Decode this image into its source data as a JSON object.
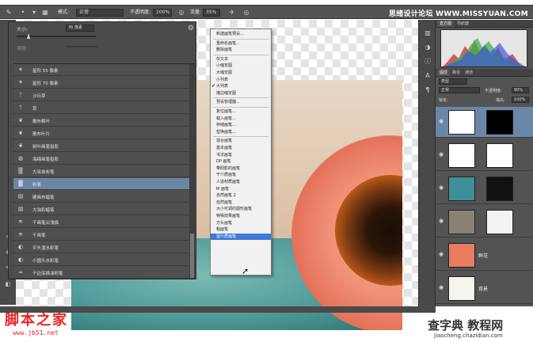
{
  "options_bar": {
    "mode_label": "模式:",
    "mode_value": "正常",
    "opacity_label": "不透明度:",
    "opacity_value": "100%",
    "flow_label": "流量:",
    "flow_value": "35%",
    "watermark": "思绪设计论坛 WWW.MISSYUAN.COM"
  },
  "brush_picker": {
    "size_label": "大小:",
    "size_value": "36 像素",
    "hardness_label": "硬度:",
    "items": [
      {
        "label": "星形 55 像素",
        "icon": "brush-star-icon",
        "selected": false
      },
      {
        "label": "星形 70 像素",
        "icon": "brush-star-icon",
        "selected": false
      },
      {
        "label": "沙丘草",
        "icon": "brush-grass-icon",
        "selected": false
      },
      {
        "label": "草",
        "icon": "brush-grass-icon",
        "selected": false
      },
      {
        "label": "散布枫叶",
        "icon": "brush-leaf-icon",
        "selected": false
      },
      {
        "label": "散布叶片",
        "icon": "brush-leaf-icon",
        "selected": false
      },
      {
        "label": "树叶画笔投影",
        "icon": "brush-leaf-icon",
        "selected": false
      },
      {
        "label": "海绵画笔投影",
        "icon": "brush-sponge-icon",
        "selected": false
      },
      {
        "label": "大涂抹炭笔",
        "icon": "brush-charcoal-icon",
        "selected": false
      },
      {
        "label": "粉笔",
        "icon": "brush-chalk-icon",
        "selected": true
      },
      {
        "label": "硬画布蜡笔",
        "icon": "brush-crayon-icon",
        "selected": false
      },
      {
        "label": "大油彩蜡笔",
        "icon": "brush-crayon-icon",
        "selected": false
      },
      {
        "label": "干画笔尖浅描",
        "icon": "brush-dry-icon",
        "selected": false
      },
      {
        "label": "干画笔",
        "icon": "brush-dry-icon",
        "selected": false
      },
      {
        "label": "平头湿水彩笔",
        "icon": "brush-wet-icon",
        "selected": false
      },
      {
        "label": "小圆头水彩笔",
        "icon": "brush-wet-icon",
        "selected": false
      },
      {
        "label": "干边深描油彩笔",
        "icon": "brush-oil-icon",
        "selected": false
      }
    ]
  },
  "context_menu": {
    "items": [
      {
        "label": "新建画笔预设...",
        "type": "item"
      },
      {
        "type": "sep"
      },
      {
        "label": "重命名画笔...",
        "type": "item"
      },
      {
        "label": "删除画笔",
        "type": "item"
      },
      {
        "type": "sep"
      },
      {
        "label": "仅文本",
        "type": "item"
      },
      {
        "label": "小缩览图",
        "type": "item"
      },
      {
        "label": "大缩览图",
        "type": "item"
      },
      {
        "label": "小列表",
        "type": "item"
      },
      {
        "label": "大列表",
        "type": "item",
        "checked": true
      },
      {
        "label": "描边缩览图",
        "type": "item"
      },
      {
        "type": "sep"
      },
      {
        "label": "预设管理器...",
        "type": "item"
      },
      {
        "type": "sep"
      },
      {
        "label": "复位画笔...",
        "type": "item"
      },
      {
        "label": "载入画笔...",
        "type": "item"
      },
      {
        "label": "存储画笔...",
        "type": "item"
      },
      {
        "label": "替换画笔...",
        "type": "item"
      },
      {
        "type": "sep"
      },
      {
        "label": "混合画笔",
        "type": "item"
      },
      {
        "label": "基本画笔",
        "type": "item"
      },
      {
        "label": "书法画笔",
        "type": "item"
      },
      {
        "label": "DP 画笔",
        "type": "item"
      },
      {
        "label": "带阴影的画笔",
        "type": "item"
      },
      {
        "label": "干介质画笔",
        "type": "item"
      },
      {
        "label": "人造材质画笔",
        "type": "item"
      },
      {
        "label": "M 画笔",
        "type": "item"
      },
      {
        "label": "自然画笔 2",
        "type": "item"
      },
      {
        "label": "自然画笔",
        "type": "item"
      },
      {
        "label": "大小可调的圆形画笔",
        "type": "item"
      },
      {
        "label": "特殊效果画笔",
        "type": "item"
      },
      {
        "label": "方头画笔",
        "type": "item"
      },
      {
        "label": "粗画笔",
        "type": "item"
      },
      {
        "label": "湿介质画笔",
        "type": "item",
        "highlighted": true
      }
    ]
  },
  "panels": {
    "top_tabs": [
      "直方图",
      "导航器"
    ],
    "layer_tabs": [
      "图层",
      "路径",
      "通道"
    ],
    "kind_label": "类型",
    "blend_value": "正常",
    "opacity_label": "不透明度:",
    "opacity_value": "90%",
    "lock_label": "锁定:",
    "fill_label": "填充:",
    "fill_value": "100%",
    "layers": [
      {
        "name": "",
        "selected": true
      },
      {
        "name": "",
        "selected": false
      },
      {
        "name": "",
        "selected": false
      },
      {
        "name": "",
        "selected": false
      },
      {
        "name": "鲜花",
        "selected": false
      },
      {
        "name": "背景",
        "selected": false
      }
    ]
  },
  "watermarks": {
    "bottom_left": "脚本之家",
    "bottom_left_url": "www.jb51.net",
    "bottom_right": "查字典 教程网",
    "bottom_right_url": "jiaocheng.chazidian.com"
  },
  "colors": {
    "accent": "#3d7ad8",
    "selection": "#6a86a4",
    "panel": "#535353"
  }
}
